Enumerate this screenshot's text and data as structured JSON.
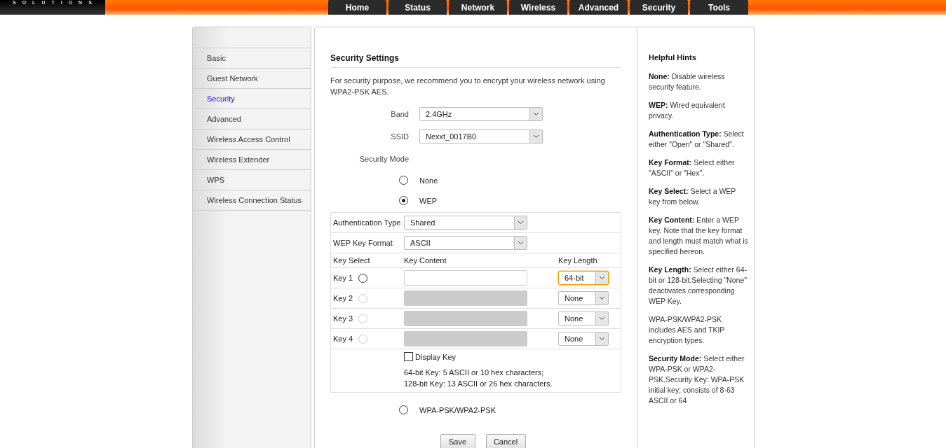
{
  "logo": "SOLUTIONS",
  "nav": [
    "Home",
    "Status",
    "Network",
    "Wireless",
    "Advanced",
    "Security",
    "Tools"
  ],
  "sidebar": {
    "items": [
      {
        "label": "Basic",
        "selected": false
      },
      {
        "label": "Guest Network",
        "selected": false
      },
      {
        "label": "Security",
        "selected": true
      },
      {
        "label": "Advanced",
        "selected": false
      },
      {
        "label": "Wireless Access Control",
        "selected": false
      },
      {
        "label": "Wireless Extender",
        "selected": false
      },
      {
        "label": "WPS",
        "selected": false
      },
      {
        "label": "Wireless Connection Status",
        "selected": false
      }
    ]
  },
  "main": {
    "title": "Security Settings",
    "intro": "For security purpose, we recommend you to encrypt your wireless network using WPA2-PSK AES.",
    "band": {
      "label": "Band",
      "value": "2.4GHz"
    },
    "ssid": {
      "label": "SSID",
      "value": "Nexxt_0017B0"
    },
    "security_mode": {
      "label": "Security Mode",
      "options": [
        {
          "label": "None",
          "selected": false
        },
        {
          "label": "WEP",
          "selected": true
        },
        {
          "label": "WPA-PSK/WPA2-PSK",
          "selected": false
        }
      ]
    },
    "wep": {
      "auth": {
        "label": "Authentication Type",
        "value": "Shared"
      },
      "format": {
        "label": "WEP Key Format",
        "value": "ASCII"
      },
      "columns": [
        "Key Select",
        "Key Content",
        "Key Length"
      ],
      "keys": [
        {
          "label": "Key 1",
          "selected": false,
          "disabled": false,
          "length": "64-bit",
          "focused": true
        },
        {
          "label": "Key 2",
          "selected": false,
          "disabled": true,
          "length": "None",
          "focused": false
        },
        {
          "label": "Key 3",
          "selected": false,
          "disabled": true,
          "length": "None",
          "focused": false
        },
        {
          "label": "Key 4",
          "selected": false,
          "disabled": true,
          "length": "None",
          "focused": false
        }
      ],
      "display_key": {
        "label": "Display Key",
        "checked": false
      },
      "note": [
        "64-bit Key: 5 ASCII or 10 hex characters;",
        "128-bit Key: 13 ASCII or 26 hex characters."
      ]
    },
    "buttons": [
      "Save",
      "Cancel"
    ]
  },
  "hints": {
    "title": "Helpful Hints",
    "items": [
      "**None:** Disable wireless security feature.",
      "**WEP:** Wired equivalent privacy.",
      "**Authentication Type:** Select either \"Open\" or \"Shared\".",
      "**Key Format:** Select either \"ASCII\" or \"Hex\".",
      "**Key Select:** Select a WEP key from below.",
      "**Key Content:** Enter a WEP key. Note that the key format and length must match what is specified hereon.",
      "**Key Length:** Select either 64-bit or 128-bit.Selecting \"None\" deactivates corresponding WEP Key.",
      "WPA-PSK/WPA2-PSK includes AES and TKIP encryption types.",
      "**Security Mode:** Select either WPA-PSK or WPA2-PSK.Security Key: WPA-PSK initial key; consists of 8-63 ASCII or 64"
    ]
  }
}
